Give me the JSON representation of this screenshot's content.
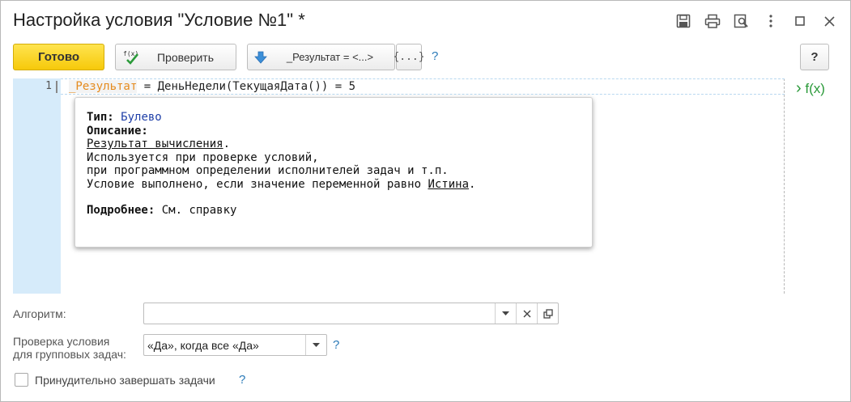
{
  "window": {
    "title": "Настройка условия \"Условие №1\" *"
  },
  "toolbar": {
    "done_label": "Готово",
    "check_label": "Проверить",
    "check_icon_text": "f(x)",
    "result_label": "_Результат = <...>",
    "braces_label": "{...}",
    "help_mark": "?",
    "help_button_label": "?"
  },
  "editor": {
    "line_number": "1",
    "code_var": "_Результат",
    "code_rest": " = ДеньНедели(ТекущаяДата()) = 5",
    "side_chevron": "›",
    "side_label": "f(x)"
  },
  "tooltip": {
    "type_label": "Тип:",
    "type_value": "Булево",
    "desc_label": "Описание:",
    "desc_link": "Результат вычисления",
    "desc_link_suffix": ".",
    "line2": "Используется при проверке условий,",
    "line3": "при программном определении исполнителей задач и т.п.",
    "line4_prefix": "Условие выполнено, если значение переменной равно ",
    "line4_link": "Истина",
    "line4_suffix": ".",
    "more_label": "Подробнее:",
    "more_value": "См. справку"
  },
  "form": {
    "algorithm_label": "Алгоритм:",
    "algorithm_value": "",
    "group_label_line1": "Проверка условия",
    "group_label_line2": "для групповых задач:",
    "group_value": "«Да», когда все «Да»",
    "group_help": "?",
    "force_label": "Принудительно завершать задачи",
    "force_help": "?",
    "force_checked": false
  },
  "colors": {
    "primary_button": "#f6c90a",
    "gutter": "#d6ebfa",
    "code_variable": "#e58a1c",
    "type_value": "#1f3fa8",
    "help_mark": "#2a7ab8",
    "fx_side": "#2b9a3a"
  },
  "icons": {
    "save": "floppy-disk",
    "print": "printer",
    "preview": "magnifier-page",
    "more": "vertical-ellipsis",
    "maximize": "square",
    "close": "x",
    "result": "blue-down-arrow",
    "check": "green-check-fx"
  }
}
